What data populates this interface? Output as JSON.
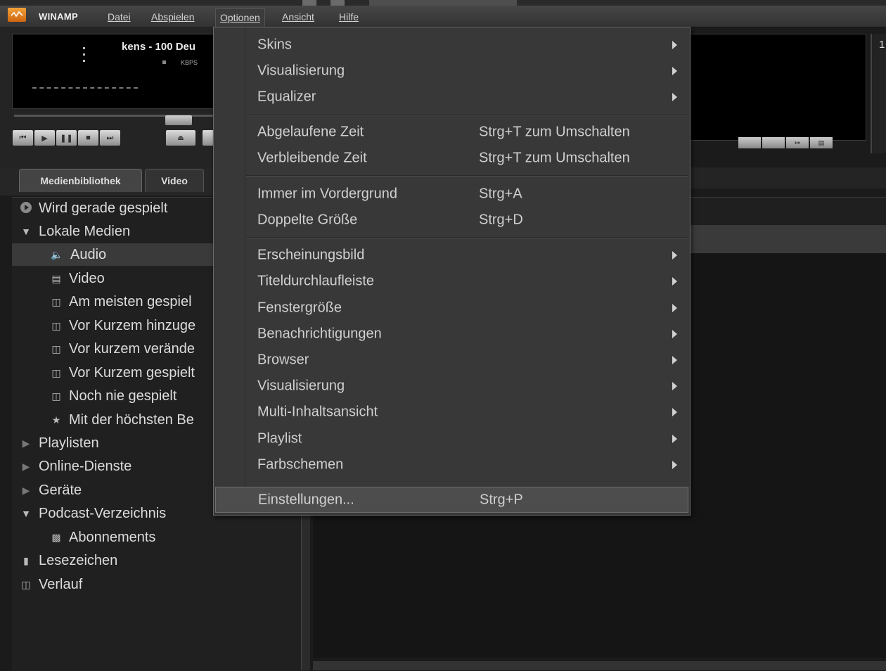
{
  "app": {
    "name": "WINAMP"
  },
  "menubar": {
    "items": [
      {
        "label": "Datei"
      },
      {
        "label": "Abspielen"
      },
      {
        "label": "Optionen"
      },
      {
        "label": "Ansicht"
      },
      {
        "label": "Hilfe"
      }
    ]
  },
  "player": {
    "track_title": "kens - 100 Deu",
    "kbps_label": "KBPS",
    "right_number": "1"
  },
  "tabs": [
    {
      "label": "Medienbibliothek"
    },
    {
      "label": "Video"
    }
  ],
  "tree": {
    "items": [
      {
        "label": "Wird gerade gespielt",
        "icon": "play-circle-icon"
      },
      {
        "label": "Lokale Medien",
        "icon": "expanded-triangle-icon"
      },
      {
        "label": "Audio",
        "icon": "speaker-icon"
      },
      {
        "label": "Video",
        "icon": "film-icon"
      },
      {
        "label": "Am meisten gespiel",
        "icon": "smart-view-icon"
      },
      {
        "label": "Vor Kurzem hinzuge",
        "icon": "smart-view-icon"
      },
      {
        "label": "Vor kurzem verände",
        "icon": "smart-view-icon"
      },
      {
        "label": "Vor Kurzem gespielt",
        "icon": "smart-view-icon"
      },
      {
        "label": "Noch nie gespielt",
        "icon": "question-doc-icon"
      },
      {
        "label": "Mit der höchsten Be",
        "icon": "star-doc-icon"
      },
      {
        "label": "Playlisten",
        "icon": "collapsed-triangle-icon"
      },
      {
        "label": "Online-Dienste",
        "icon": "collapsed-triangle-icon"
      },
      {
        "label": "Geräte",
        "icon": "collapsed-triangle-icon"
      },
      {
        "label": "Podcast-Verzeichnis",
        "icon": "expanded-triangle-icon"
      },
      {
        "label": "Abonnements",
        "icon": "folder-icon"
      },
      {
        "label": "Lesezeichen",
        "icon": "bookmark-icon"
      },
      {
        "label": "Verlauf",
        "icon": "history-icon"
      }
    ]
  },
  "options_menu": {
    "items": [
      {
        "label": "Skins",
        "submenu": true
      },
      {
        "label": "Visualisierung",
        "submenu": true
      },
      {
        "label": "Equalizer",
        "submenu": true
      },
      {
        "label": "Abgelaufene Zeit",
        "shortcut": "Strg+T zum Umschalten"
      },
      {
        "label": "Verbleibende Zeit",
        "shortcut": "Strg+T zum Umschalten"
      },
      {
        "label": "Immer im Vordergrund",
        "shortcut": "Strg+A"
      },
      {
        "label": "Doppelte Größe",
        "shortcut": "Strg+D"
      },
      {
        "label": "Erscheinungsbild",
        "submenu": true
      },
      {
        "label": "Titeldurchlaufleiste",
        "submenu": true
      },
      {
        "label": "Fenstergröße",
        "submenu": true
      },
      {
        "label": "Benachrichtigungen",
        "submenu": true
      },
      {
        "label": "Browser",
        "submenu": true
      },
      {
        "label": "Visualisierung",
        "submenu": true
      },
      {
        "label": "Multi-Inhaltsansicht",
        "submenu": true
      },
      {
        "label": "Playlist",
        "submenu": true
      },
      {
        "label": "Farbschemen",
        "submenu": true
      },
      {
        "label": "Einstellungen...",
        "shortcut": "Strg+P"
      }
    ]
  }
}
